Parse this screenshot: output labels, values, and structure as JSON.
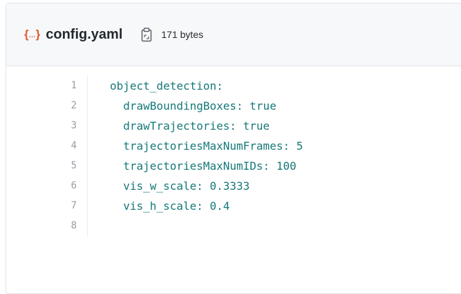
{
  "file": {
    "icon": "code-file-icon",
    "name": "config.yaml",
    "copy_icon": "clipboard-icon",
    "size": "171 bytes"
  },
  "colors": {
    "icon_accent": "#e05a2b",
    "code_text": "#167878",
    "line_number": "#959da5"
  },
  "code": {
    "lines": [
      {
        "num": "1",
        "text": "object_detection:"
      },
      {
        "num": "2",
        "text": "  drawBoundingBoxes: true"
      },
      {
        "num": "3",
        "text": "  drawTrajectories: true"
      },
      {
        "num": "4",
        "text": "  trajectoriesMaxNumFrames: 5"
      },
      {
        "num": "5",
        "text": "  trajectoriesMaxNumIDs: 100"
      },
      {
        "num": "6",
        "text": "  vis_w_scale: 0.3333"
      },
      {
        "num": "7",
        "text": "  vis_h_scale: 0.4"
      },
      {
        "num": "8",
        "text": ""
      }
    ]
  }
}
